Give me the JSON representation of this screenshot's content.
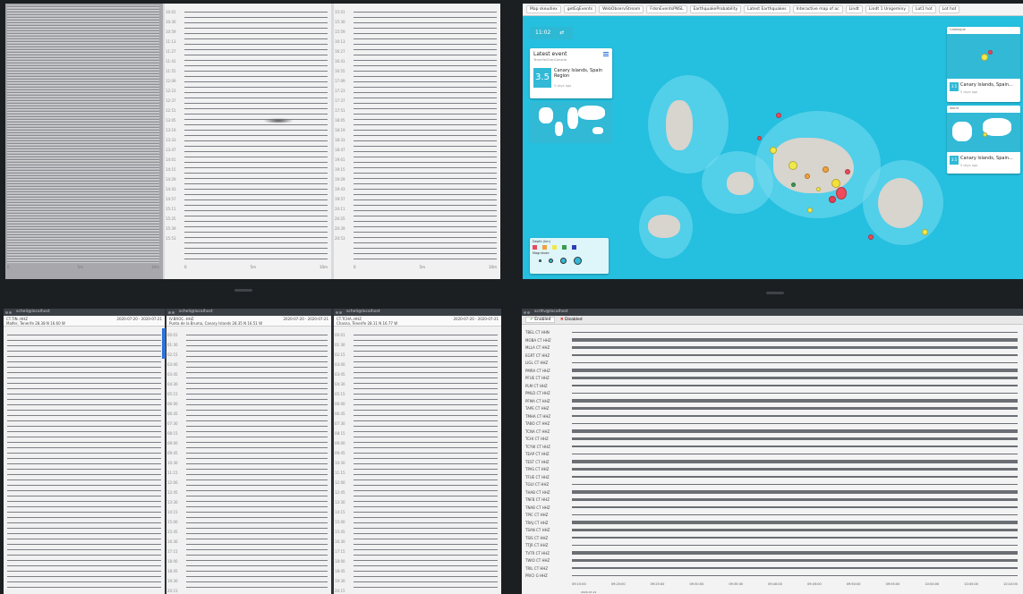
{
  "top_left": {
    "panels": [
      {
        "axis": [
          "0",
          "5m",
          "10m"
        ],
        "ticks": [
          "05:01",
          "05:30",
          "05:59",
          "06:13",
          "06:27",
          "06:41",
          "06:55",
          "07:09",
          "07:23",
          "07:37",
          "07:51",
          "08:05",
          "08:19",
          "08:33",
          "08:47",
          "09:01",
          "09:15",
          "09:29",
          "09:43",
          "09:57",
          "10:11",
          "10:25",
          "10:39",
          "10:53"
        ]
      },
      {
        "axis": [
          "0",
          "5m",
          "10m"
        ],
        "ticks": [
          "10:01",
          "10:30",
          "10:59",
          "11:13",
          "11:27",
          "11:41",
          "11:55",
          "12:09",
          "12:23",
          "12:37",
          "12:51",
          "13:05",
          "13:19",
          "13:33",
          "13:47",
          "14:01",
          "14:15",
          "14:29",
          "14:43",
          "14:57",
          "15:11",
          "15:25",
          "15:39",
          "15:53"
        ]
      },
      {
        "axis": [
          "0",
          "5m",
          "10m"
        ],
        "ticks": [
          "15:01",
          "15:30",
          "15:59",
          "16:13",
          "16:27",
          "16:41",
          "16:55",
          "17:09",
          "17:23",
          "17:37",
          "17:51",
          "18:05",
          "18:19",
          "18:33",
          "18:47",
          "19:01",
          "19:15",
          "19:29",
          "19:43",
          "19:57",
          "20:11",
          "20:25",
          "20:39",
          "20:53"
        ]
      }
    ]
  },
  "map": {
    "tabs": [
      "Map skeudiex",
      "getEqEvents",
      "WebObservStream",
      "FdsnEventsPNSL",
      "EarthquakeProbability",
      "Latest Earthquakes",
      "Interactive map of ac",
      "Lindt",
      "Lindt 1 Unigeminy",
      "Lot1 hot",
      "Lot hot"
    ],
    "clock": "11:02",
    "latest_event": {
      "title": "Latest event",
      "subtitle": "Tenerife/GranCanaria",
      "magnitude": "3.5",
      "region": "Canary Islands, Spain Region",
      "age": "5 days ago"
    },
    "side_cards": [
      {
        "header": "Catalogue",
        "title": "Canary Islands, Spain...",
        "age": "5 days ago",
        "mag": "3.5"
      },
      {
        "header": "World",
        "title": "Canary Islands, Spain...",
        "age": "5 days ago",
        "mag": "3.5"
      }
    ],
    "legend": {
      "title": "Depth (km)",
      "size_label": "Magnitude"
    }
  },
  "bottom_left": {
    "windows": [
      {
        "title": "scheli@localhost",
        "station": "CT.TIN..HHZ",
        "location": "Malfer, Tenerife 28.38 N 16.60 W",
        "date": "2020-07-20 - 2020-07-21"
      },
      {
        "title": "scheli@localhost",
        "station": "IV.BROC..HHZ",
        "location": "Punta de la Bruma, Canary Islands 28.35 N 16.51 W",
        "date": "2020-07-20 - 2020-07-21"
      },
      {
        "title": "scheli@localhost",
        "station": "CT.TCHA..HHZ",
        "location": "Chasna, Tenerife 28.11 N 16.77 W",
        "date": "2020-07-20 - 2020-07-21"
      }
    ],
    "ticks": [
      "00:01",
      "01:30",
      "02:15",
      "03:00",
      "03:45",
      "04:30",
      "05:15",
      "06:00",
      "06:45",
      "07:30",
      "08:15",
      "09:00",
      "09:45",
      "10:30",
      "11:15",
      "12:00",
      "12:45",
      "13:30",
      "14:15",
      "15:00",
      "15:45",
      "16:30",
      "17:15",
      "18:00",
      "18:45",
      "19:30",
      "20:15",
      "21:00"
    ]
  },
  "bottom_right": {
    "title": "scrttv@localhost",
    "tabs": [
      "Enabled",
      "Disabled"
    ],
    "stations": [
      "TBEL CT HHN",
      "MOBA CT HHZ",
      "MLLA CT HHZ",
      "EGRT CT HHZ",
      "LIGL CT HHZ",
      "PMRA CT HHZ",
      "PFUE CT HHZ",
      "PLM CT HHZ",
      "PMLD CT HHZ",
      "PFMA CT HHZ",
      "TAPE CT HHZ",
      "TMHA CT HHZ",
      "TABO CT HHZ",
      "TCNA CT HHZ",
      "TCHI CT HHZ",
      "TCYW CT HHZ",
      "TEAP CT HHZ",
      "TEST CT HHZ",
      "TPAS CT HHZ",
      "TFUE CT HHZ",
      "TGUI CT HHZ",
      "THAB CT HHZ",
      "TNFB CT HHZ",
      "TNAB CT HHZ",
      "TPIC CT HHZ",
      "TRAJ CT HHZ",
      "TSAN CT HHZ",
      "TSIS CT HHZ",
      "TTJR CT HHZ",
      "TVTR CT HHZ",
      "TWIO CT HHZ",
      "TRIL CT HHZ",
      "PRICI G HHZ"
    ],
    "time_axis": [
      "09:15:00",
      "09:20:00",
      "09:25:00",
      "09:30:00",
      "09:35:00",
      "09:40:00",
      "09:45:00",
      "09:50:00",
      "09:55:00",
      "10:00:00",
      "10:05:00",
      "10:10:00"
    ],
    "date": "2020-07-21"
  }
}
